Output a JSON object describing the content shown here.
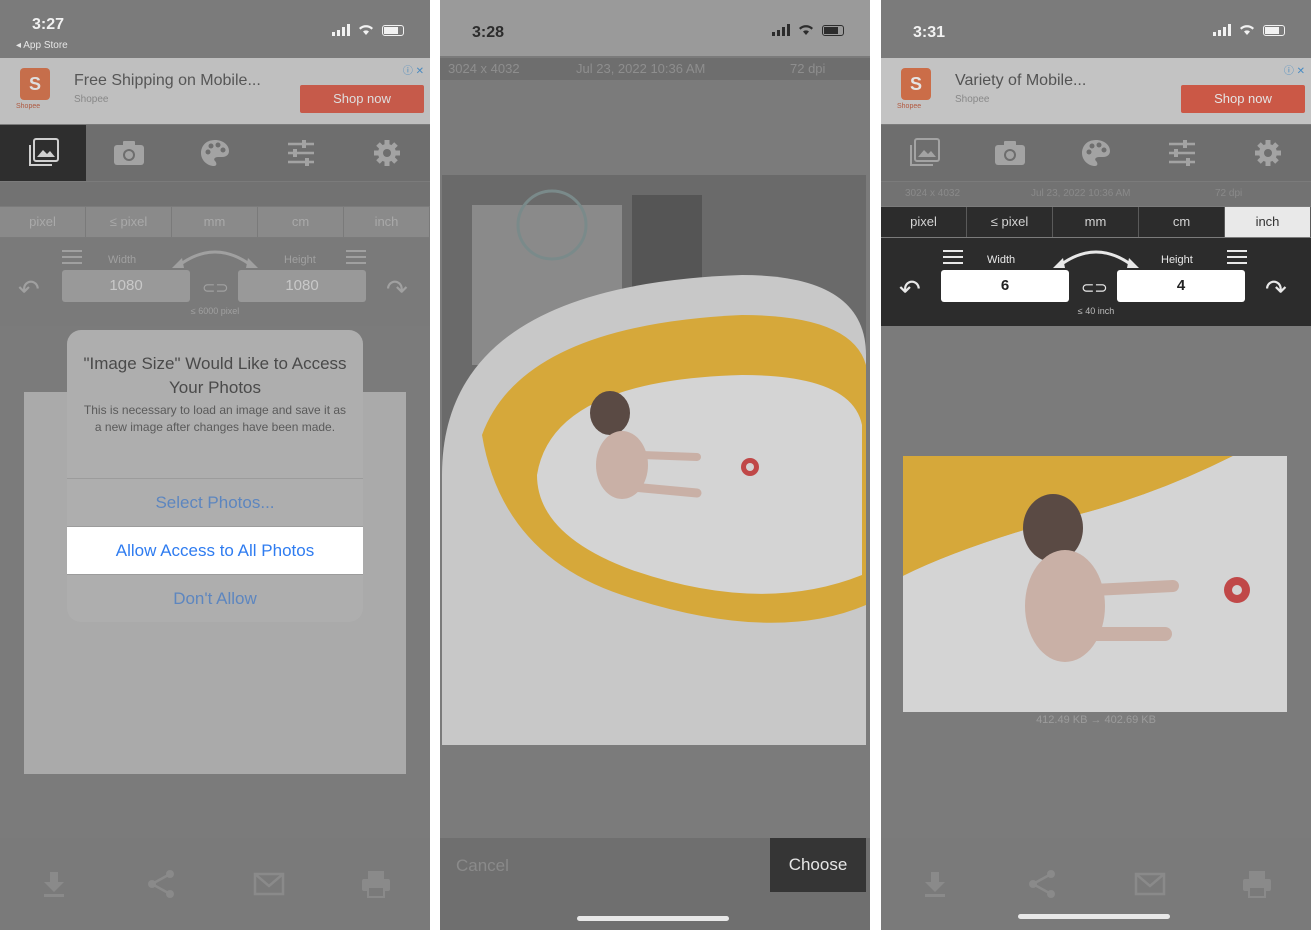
{
  "panels": [
    {
      "status": {
        "time": "3:27",
        "back": "◂ App Store"
      },
      "ad": {
        "title": "Free Shipping on Mobile...",
        "sub": "Shopee",
        "cta": "Shop now",
        "logo": "S",
        "logo_caption": "Shopee"
      },
      "units": [
        "pixel",
        "≤ pixel",
        "mm",
        "cm",
        "inch"
      ],
      "size": {
        "width_label": "Width",
        "height_label": "Height",
        "width": "1080",
        "height": "1080",
        "caption": "≤ 6000 pixel"
      },
      "alert": {
        "title": "\"Image Size\" Would Like to Access Your Photos",
        "message": "This is necessary to load an image and save it as a new image after changes have been made.",
        "actions": [
          "Select Photos...",
          "Allow Access to All Photos",
          "Don't Allow"
        ]
      }
    },
    {
      "status": {
        "time": "3:28"
      },
      "meta": {
        "dims": "3024 x 4032",
        "date": "Jul 23, 2022 10:36 AM",
        "dpi": "72 dpi"
      },
      "bottom": {
        "cancel": "Cancel",
        "choose": "Choose"
      }
    },
    {
      "status": {
        "time": "3:31"
      },
      "ad": {
        "title": "Variety of Mobile...",
        "sub": "Shopee",
        "cta": "Shop now",
        "logo": "S",
        "logo_caption": "Shopee"
      },
      "info": {
        "dims": "3024 x 4032",
        "date": "Jul 23, 2022 10:36 AM",
        "dpi": "72 dpi"
      },
      "units": [
        "pixel",
        "≤ pixel",
        "mm",
        "cm",
        "inch"
      ],
      "selected_unit": "inch",
      "size": {
        "width_label": "Width",
        "height_label": "Height",
        "width": "6",
        "height": "4",
        "caption": "≤ 40 inch"
      },
      "filesize": "412.49 KB  →  402.69 KB"
    }
  ],
  "colors": {
    "accent": "#2f7cf0",
    "shopee": "#e0503a",
    "pool_yellow": "#e6b43a"
  }
}
